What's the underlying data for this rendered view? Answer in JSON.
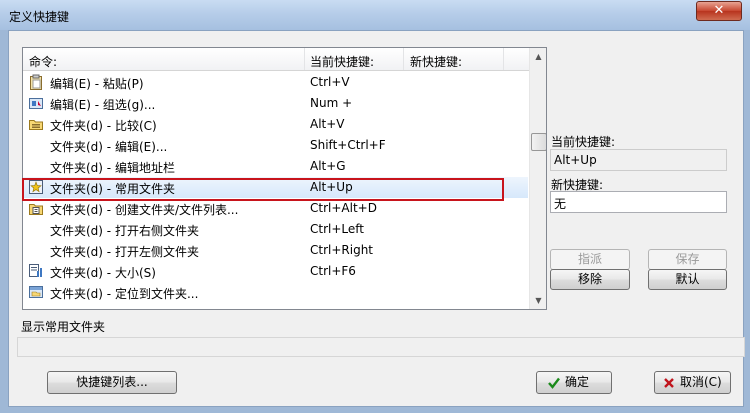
{
  "window": {
    "title": "定义快捷键",
    "close_glyph": "✕"
  },
  "list": {
    "columns": {
      "command": "命令:",
      "current": "当前快捷键:",
      "new": "新快捷键:"
    },
    "rows": [
      {
        "icon": "clipboard-icon",
        "command": "编辑(E) - 粘贴(P)",
        "shortcut": "Ctrl+V"
      },
      {
        "icon": "select-group-icon",
        "command": "编辑(E) - 组选(g)...",
        "shortcut": "Num +"
      },
      {
        "icon": "folder-compare-icon",
        "command": "文件夹(d) - 比较(C)",
        "shortcut": "Alt+V"
      },
      {
        "icon": "",
        "command": "文件夹(d) - 编辑(E)...",
        "shortcut": "Shift+Ctrl+F"
      },
      {
        "icon": "",
        "command": "文件夹(d) - 编辑地址栏",
        "shortcut": "Alt+G"
      },
      {
        "icon": "favorite-folder-icon",
        "command": "文件夹(d) - 常用文件夹",
        "shortcut": "Alt+Up",
        "selected": true
      },
      {
        "icon": "new-folder-list-icon",
        "command": "文件夹(d) - 创建文件夹/文件列表...",
        "shortcut": "Ctrl+Alt+D"
      },
      {
        "icon": "",
        "command": "文件夹(d) - 打开右侧文件夹",
        "shortcut": "Ctrl+Left"
      },
      {
        "icon": "",
        "command": "文件夹(d) - 打开左侧文件夹",
        "shortcut": "Ctrl+Right"
      },
      {
        "icon": "folder-size-icon",
        "command": "文件夹(d) - 大小(S)",
        "shortcut": "Ctrl+F6"
      },
      {
        "icon": "locate-folder-icon",
        "command": "文件夹(d) - 定位到文件夹...",
        "shortcut": ""
      }
    ]
  },
  "side": {
    "current_label": "当前快捷键:",
    "current_value": "Alt+Up",
    "new_label": "新快捷键:",
    "new_value": "无",
    "assign": "指派",
    "save": "保存",
    "remove": "移除",
    "default": "默认"
  },
  "description": "显示常用文件夹",
  "footer": {
    "list_button": "快捷键列表...",
    "ok": "确定",
    "cancel": "取消(C)"
  }
}
